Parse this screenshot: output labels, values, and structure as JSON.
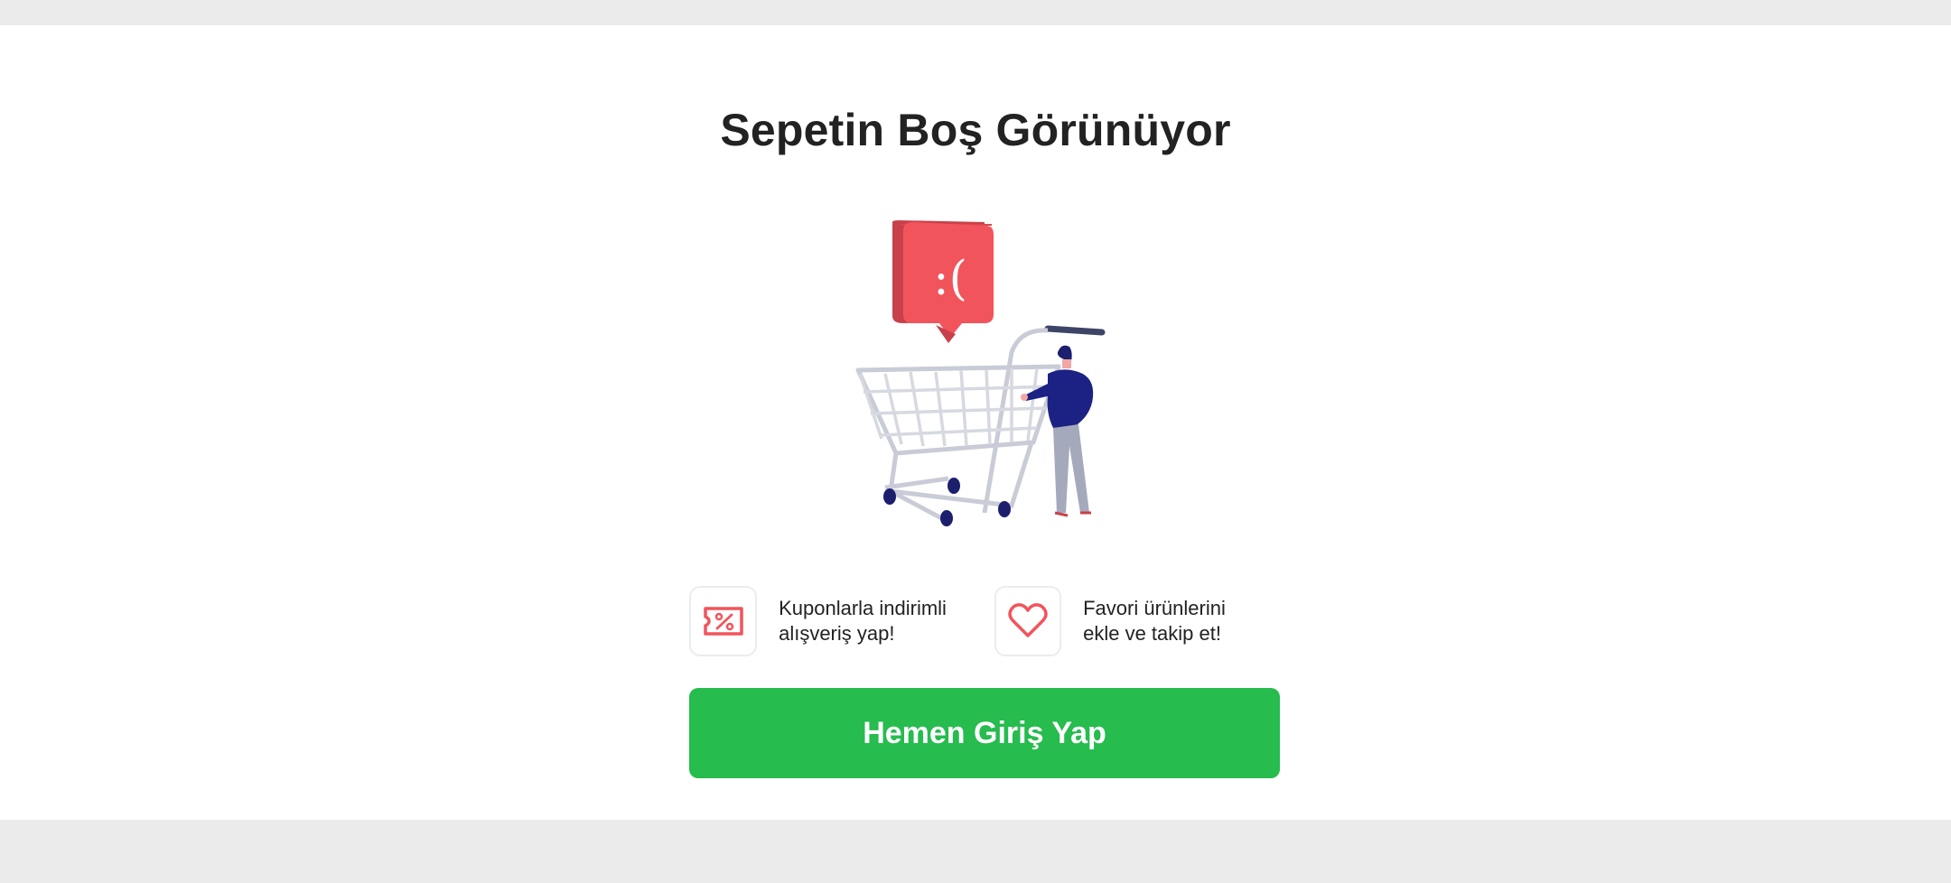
{
  "empty_cart": {
    "title": "Sepetin Boş Görünüyor",
    "bubble_text": ":(",
    "benefits": [
      {
        "icon": "coupon-percent-icon",
        "line1": "Kuponlarla indirimli",
        "line2": "alışveriş yap!"
      },
      {
        "icon": "heart-icon",
        "line1": "Favori ürünlerini",
        "line2": "ekle ve takip et!"
      }
    ],
    "cta_label": "Hemen Giriş Yap"
  },
  "colors": {
    "accent_red": "#f2545b",
    "cta_green": "#26bc4e",
    "title_text": "#222222",
    "page_background": "#ebebeb"
  }
}
